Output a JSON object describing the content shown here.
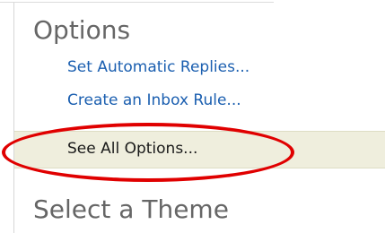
{
  "options_section": {
    "heading": "Options",
    "links": {
      "automatic_replies": "Set Automatic Replies...",
      "inbox_rule": "Create an Inbox Rule..."
    },
    "see_all_options": "See All Options..."
  },
  "theme_section": {
    "heading": "Select a Theme"
  },
  "colors": {
    "link": "#1b5fb0",
    "heading": "#666666",
    "row_highlight": "#efeedd",
    "annotation": "#e00000"
  }
}
